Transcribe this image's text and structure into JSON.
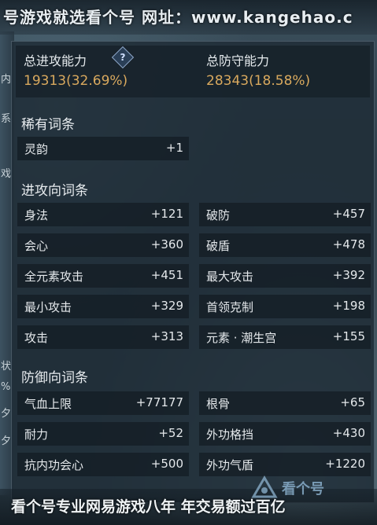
{
  "banner_top": {
    "watermark": "号游戏就选看个号  网址：www.kangehao.c"
  },
  "left_edge": [
    "内",
    "系",
    "戏",
    "状",
    "%",
    "夕",
    "夕"
  ],
  "summary": {
    "attack_label": "总进攻能力",
    "attack_value": "19313(32.69%)",
    "defense_label": "总防守能力",
    "defense_value": "28343(18.58%)",
    "help_icon": "?"
  },
  "sections": {
    "rare": "稀有词条",
    "attack": "进攻向词条",
    "defense": "防御向词条"
  },
  "rare_stats": [
    {
      "name": "灵韵",
      "value": "+1"
    }
  ],
  "attack_stats": [
    {
      "name": "身法",
      "value": "+121"
    },
    {
      "name": "破防",
      "value": "+457"
    },
    {
      "name": "会心",
      "value": "+360"
    },
    {
      "name": "破盾",
      "value": "+478"
    },
    {
      "name": "全元素攻击",
      "value": "+451"
    },
    {
      "name": "最大攻击",
      "value": "+392"
    },
    {
      "name": "最小攻击",
      "value": "+329"
    },
    {
      "name": "首领克制",
      "value": "+198"
    },
    {
      "name": "攻击",
      "value": "+313"
    },
    {
      "name": "元素 · 潮生宫",
      "value": "+155"
    }
  ],
  "defense_stats": [
    {
      "name": "气血上限",
      "value": "+77177"
    },
    {
      "name": "根骨",
      "value": "+65"
    },
    {
      "name": "耐力",
      "value": "+52"
    },
    {
      "name": "外功格挡",
      "value": "+430"
    },
    {
      "name": "抗内功会心",
      "value": "+500"
    },
    {
      "name": "外功气盾",
      "value": "+1220"
    }
  ],
  "banner_bottom": {
    "watermark": "看个号专业网易游戏八年  年交易额过百亿"
  },
  "logo": {
    "text": "看个号"
  }
}
